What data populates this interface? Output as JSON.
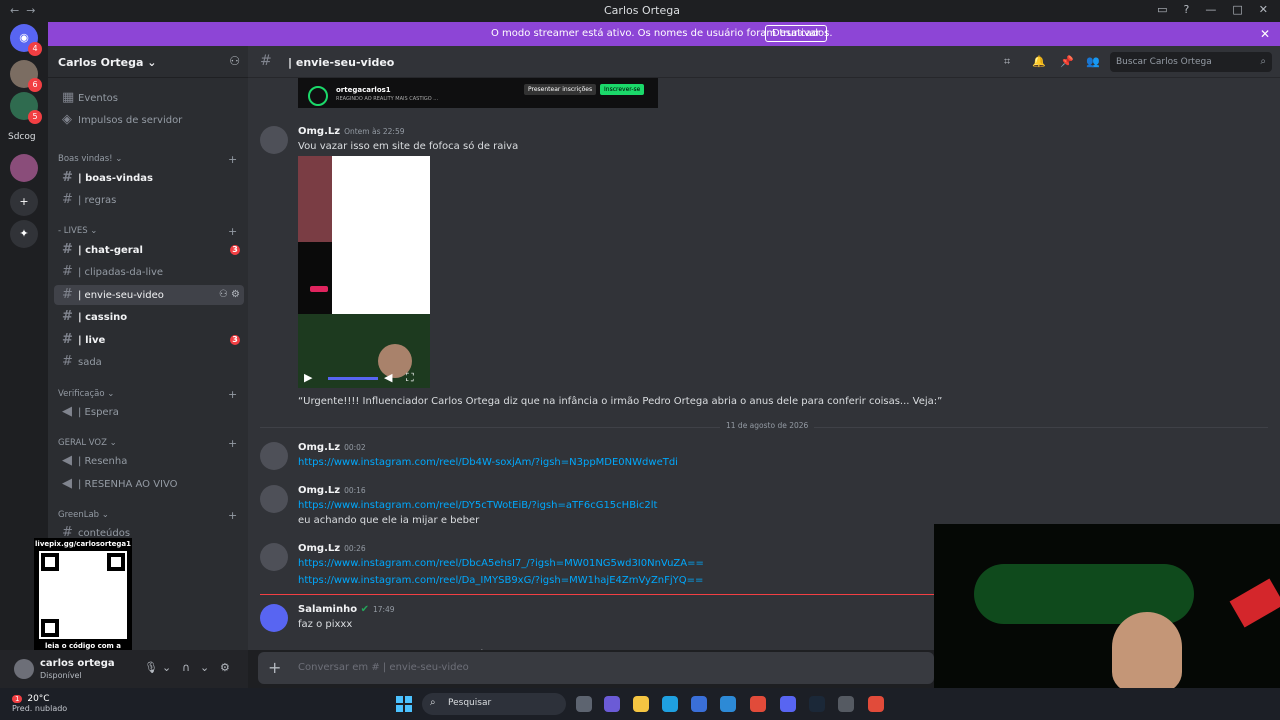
{
  "window": {
    "title": "Carlos Ortega"
  },
  "banner": {
    "text": "O modo streamer está ativo. Os nomes de usuário foram truncados.",
    "button": "Desativar"
  },
  "servers": [
    {
      "badge": "4"
    },
    {
      "badge": "6"
    },
    {
      "badge": "5"
    },
    {
      "label": "Sdcog"
    }
  ],
  "sidebar": {
    "server_name": "Carlos Ortega",
    "top_items": [
      {
        "label": "Eventos"
      },
      {
        "label": "Impulsos de servidor"
      }
    ],
    "categories": {
      "boas": "Boas vindas!",
      "lives": "- LIVES",
      "verif": "Verificação",
      "geral": "GERAL VOZ",
      "green": "GreenLab"
    },
    "channels": {
      "boas_vindas": "| boas-vindas",
      "regras": "| regras",
      "chat_geral": "| chat-geral",
      "chat_geral_count": "3",
      "clipadas": "| clipadas-da-live",
      "envie": "| envie-seu-video",
      "cassino": "| cassino",
      "live": "| live",
      "live_count": "3",
      "sada": "sada",
      "espera": "| Espera",
      "resenha": "| Resenha",
      "resenha_vivo": "| RESENHA AO VIVO",
      "conteudos": "conteúdos"
    }
  },
  "qr": {
    "url": "livepix.gg/carlosortega1",
    "caption": "leia o código com a câmera do celular."
  },
  "user": {
    "name": "carlos ortega",
    "status": "Disponível"
  },
  "header": {
    "channel": "envie-seu-video",
    "search_placeholder": "Buscar Carlos Ortega"
  },
  "embed": {
    "name": "ortegacarlos1",
    "sub": "REAGINDO AO REALITY MAIS CASTIGO ...",
    "btn1": "Presentear inscrições",
    "btn2": "Inscrever-se"
  },
  "messages": [
    {
      "author": "Omg.Lz",
      "time": "Ontem às 22:59",
      "text": "Vou vazar isso em site de fofoca só de raiva",
      "caption": "“Urgente!!!! Influenciador Carlos Ortega diz que na infância o irmão Pedro Ortega abria o anus dele para conferir coisas... Veja:”"
    },
    {
      "author": "Omg.Lz",
      "time": "00:02",
      "link": "https://www.instagram.com/reel/Db4W-soxjAm/?igsh=N3ppMDE0NWdweTdi"
    },
    {
      "author": "Omg.Lz",
      "time": "00:16",
      "link": "https://www.instagram.com/reel/DY5cTWotEiB/?igsh=aTF6cG15cHBic2lt",
      "text": "eu achando que ele ia mijar e beber"
    },
    {
      "author": "Omg.Lz",
      "time": "00:26",
      "link": "https://www.instagram.com/reel/DbcA5ehsI7_/?igsh=MW01NG5wd3I0NnVuZA==",
      "link2": "https://www.instagram.com/reel/Da_IMYSB9xG/?igsh=MW1hajE4ZmVyZnFjYQ=="
    },
    {
      "author": "Salaminho",
      "time": "17:49",
      "text": "faz o pixxx"
    }
  ],
  "date_divider": "11 de agosto de 2026",
  "composer": {
    "placeholder": "Conversar em #    |  envie-seu-video"
  },
  "taskbar": {
    "temp": "20°C",
    "weather": "Pred. nublado",
    "search": "Pesquisar",
    "weather_badge": "1"
  },
  "colors": {
    "accent": "#5865f2",
    "banner": "#8d45d6",
    "link": "#00a8fc",
    "alert": "#f23f43"
  }
}
